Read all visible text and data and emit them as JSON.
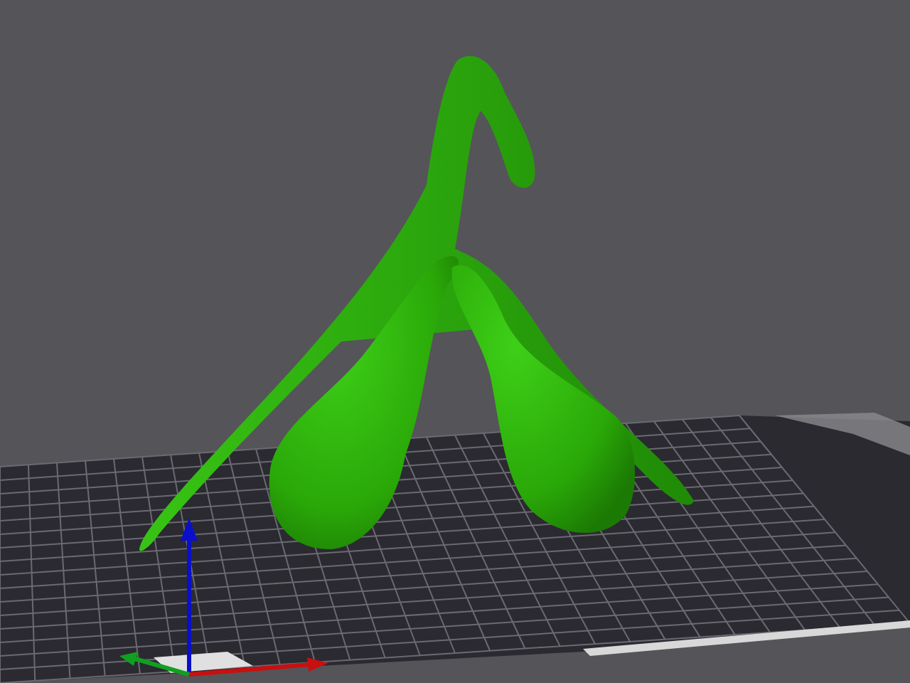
{
  "viewport": {
    "show_axes": true
  }
}
